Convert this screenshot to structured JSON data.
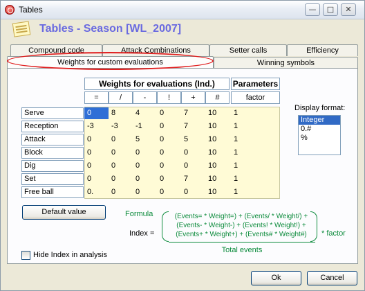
{
  "window": {
    "title": "Tables"
  },
  "header": {
    "title": "Tables - Season [WL_2007]"
  },
  "tabs_row1": [
    "Compound code",
    "Attack Combinations",
    "Setter calls",
    "Efficiency"
  ],
  "tabs_row2": [
    "Weights for custom evaluations",
    "Winning symbols"
  ],
  "table": {
    "group_header": "Weights for evaluations (Ind.)",
    "params_header": "Parameters",
    "columns": [
      "=",
      "/",
      "-",
      "!",
      "+",
      "#"
    ],
    "param_column": "factor",
    "rows": [
      {
        "label": "Serve",
        "values": [
          "0",
          "8",
          "4",
          "0",
          "7",
          "10"
        ],
        "factor": "1"
      },
      {
        "label": "Reception",
        "values": [
          "-3",
          "-3",
          "-1",
          "0",
          "7",
          "10"
        ],
        "factor": "1"
      },
      {
        "label": "Attack",
        "values": [
          "0",
          "0",
          "5",
          "0",
          "5",
          "10"
        ],
        "factor": "1"
      },
      {
        "label": "Block",
        "values": [
          "0",
          "0",
          "0",
          "0",
          "0",
          "10"
        ],
        "factor": "1"
      },
      {
        "label": "Dig",
        "values": [
          "0",
          "0",
          "0",
          "0",
          "0",
          "10"
        ],
        "factor": "1"
      },
      {
        "label": "Set",
        "values": [
          "0",
          "0",
          "0",
          "0",
          "7",
          "10"
        ],
        "factor": "1"
      },
      {
        "label": "Free ball",
        "values": [
          "0.",
          "0",
          "0",
          "0",
          "0",
          "10"
        ],
        "factor": "1"
      }
    ]
  },
  "display_format": {
    "label": "Display format:",
    "options": [
      "Integer",
      "0.#",
      "%"
    ],
    "selected": "Integer"
  },
  "buttons": {
    "default_value": "Default value",
    "ok": "Ok",
    "cancel": "Cancel"
  },
  "formula": {
    "label": "Formula",
    "index_label": "Index =",
    "line1": "(Events= * Weight=) + (Events/ * Weight/) +",
    "line2": "(Events- * Weight-) + (Events! * Weight!) +",
    "line3": "(Events+ * Weight+) + (Events# * Weight#)",
    "denominator": "Total events",
    "factor_suffix": "* factor"
  },
  "hide_index": {
    "label": "Hide Index in analysis",
    "checked": false
  },
  "colors": {
    "accent": "#6a6ae0",
    "formula_green": "#0a8a3a",
    "grid_bg": "#fffbd6",
    "highlight": "#e02020"
  }
}
